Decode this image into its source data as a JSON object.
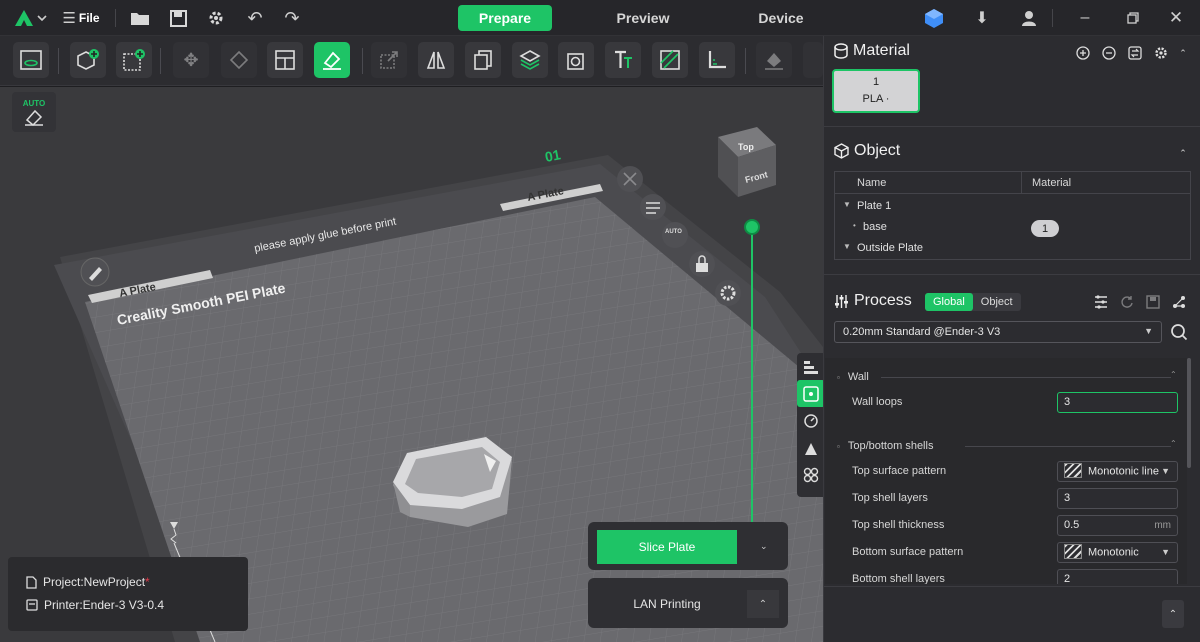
{
  "titlebar": {
    "file_label": "File",
    "tabs": [
      {
        "label": "Prepare"
      },
      {
        "label": "Preview"
      },
      {
        "label": "Device"
      }
    ]
  },
  "viewport": {
    "auto_label": "AUTO",
    "plate_number": "01",
    "plate_name_left": "A Plate",
    "plate_name_right": "A Plate",
    "glue_notice": "please apply glue before print",
    "bed_label": "Creality Smooth PEI Plate",
    "nav_cube_top": "Top",
    "nav_cube_front": "Front",
    "plate_auto_label": "AUTO",
    "slice_button": "Slice Plate",
    "lan_button": "LAN Printing",
    "project_label": "Project:NewProject",
    "project_modified": "*",
    "printer_label": "Printer:Ender-3 V3-0.4"
  },
  "material": {
    "title": "Material",
    "slot_number": "1",
    "slot_type": "PLA"
  },
  "object": {
    "title": "Object",
    "col_name": "Name",
    "col_material": "Material",
    "rows": [
      {
        "name": "Plate 1"
      },
      {
        "name": "base",
        "material": "1"
      },
      {
        "name": "Outside Plate"
      }
    ]
  },
  "process": {
    "title": "Process",
    "mode_global": "Global",
    "mode_object": "Object",
    "preset": "0.20mm Standard @Ender-3 V3",
    "groups": {
      "wall": "Wall",
      "topbottom": "Top/bottom shells"
    },
    "params": {
      "wall_loops": {
        "label": "Wall loops",
        "value": "3"
      },
      "top_surface_pattern": {
        "label": "Top surface pattern",
        "value": "Monotonic line"
      },
      "top_shell_layers": {
        "label": "Top shell layers",
        "value": "3"
      },
      "top_shell_thickness": {
        "label": "Top shell thickness",
        "value": "0.5",
        "unit": "mm"
      },
      "bottom_surface_pattern": {
        "label": "Bottom surface pattern",
        "value": "Monotonic"
      },
      "bottom_shell_layers": {
        "label": "Bottom shell layers",
        "value": "2"
      }
    }
  },
  "colors": {
    "accent": "#1ec466",
    "panel": "#2c2c30",
    "viewport": "#3a3a3d"
  }
}
